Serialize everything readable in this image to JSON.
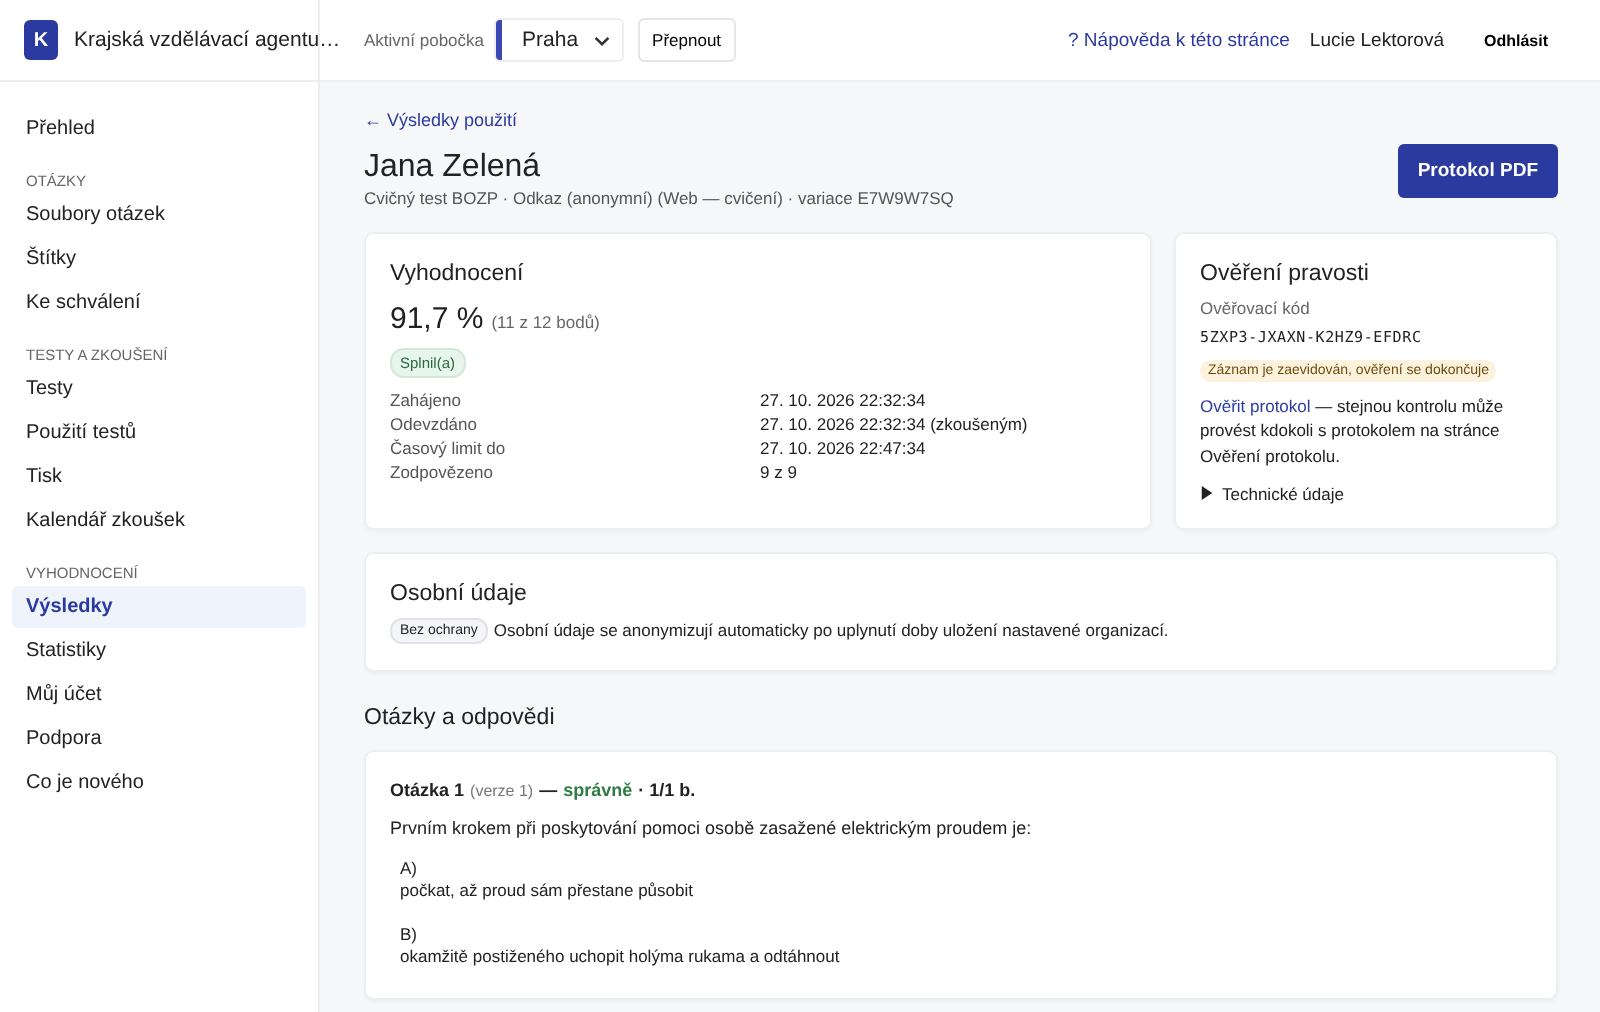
{
  "brand": {
    "logo": "K",
    "name": "Krajská vzdělávací agentu…"
  },
  "branch": {
    "label": "Aktivní pobočka",
    "value": "Praha",
    "button": "Přepnout"
  },
  "header_right": {
    "help": "? Nápověda k této stránce",
    "user": "Lucie Lektorová",
    "logout": "Odhlásit"
  },
  "sidebar": {
    "items": [
      {
        "kind": "link",
        "label": "Přehled",
        "selected": false
      },
      {
        "kind": "heading",
        "label": "OTÁZKY"
      },
      {
        "kind": "link",
        "label": "Soubory otázek",
        "selected": false
      },
      {
        "kind": "link",
        "label": "Štítky",
        "selected": false
      },
      {
        "kind": "link",
        "label": "Ke schválení",
        "selected": false
      },
      {
        "kind": "heading",
        "label": "TESTY A ZKOUŠENÍ"
      },
      {
        "kind": "link",
        "label": "Testy",
        "selected": false
      },
      {
        "kind": "link",
        "label": "Použití testů",
        "selected": false
      },
      {
        "kind": "link",
        "label": "Tisk",
        "selected": false
      },
      {
        "kind": "link",
        "label": "Kalendář zkoušek",
        "selected": false
      },
      {
        "kind": "heading",
        "label": "VYHODNOCENÍ"
      },
      {
        "kind": "link",
        "label": "Výsledky",
        "selected": true
      },
      {
        "kind": "link",
        "label": "Statistiky",
        "selected": false
      },
      {
        "kind": "link",
        "label": "Můj účet",
        "selected": false
      },
      {
        "kind": "link",
        "label": "Podpora",
        "selected": false
      },
      {
        "kind": "link",
        "label": "Co je nového",
        "selected": false
      }
    ]
  },
  "back_link": "← Výsledky použití",
  "title": "Jana Zelená",
  "subtitle": "Cvičný test BOZP · Odkaz (anonymní) (Web — cvičení) · variace E7W9W7SQ",
  "pdf_button": "Protokol PDF",
  "evaluation": {
    "title": "Vyhodnocení",
    "score": "91,7 %",
    "points": "(11 z 12 bodů)",
    "badge": "Splnil(a)",
    "passed": true,
    "rows": [
      {
        "label": "Zahájeno",
        "value": "27. 10. 2026 22:32:34"
      },
      {
        "label": "Odevzdáno",
        "value": "27. 10. 2026 22:32:34 (zkoušeným)"
      },
      {
        "label": "Časový limit do",
        "value": "27. 10. 2026 22:47:34"
      },
      {
        "label": "Zodpovězeno",
        "value": "9 z 9"
      }
    ]
  },
  "verification": {
    "title": "Ověření pravosti",
    "code_label": "Ověřovací kód",
    "code": "5ZXP3-JXAXN-K2HZ9-EFDRC",
    "status": "Záznam je zaevidován, ověření se dokončuje",
    "link": "Ověřit protokol",
    "note": " — stejnou kontrolu může provést kdokoli s protokolem na stránce Ověření protokolu.",
    "details": {
      "label": "Technické údaje",
      "expanded": false
    }
  },
  "personal": {
    "title": "Osobní údaje",
    "tag": "Bez ochrany",
    "text": "Osobní údaje se anonymizují automaticky po uplynutí doby uložení nastavené organizací."
  },
  "qa_title": "Otázky a odpovědi",
  "questions": [
    {
      "title": "Otázka 1",
      "version": "(verze 1)",
      "dash": "—",
      "result": "správně",
      "correct": true,
      "points": "· 1/1 b.",
      "text": "Prvním krokem při poskytování pomoci osobě zasažené elektrickým proudem je:",
      "answers": [
        {
          "letter": "A)",
          "text": "počkat, až proud sám přestane působit"
        },
        {
          "letter": "B)",
          "text": "okamžitě postiženého uchopit holýma rukama a odtáhnout"
        }
      ]
    }
  ]
}
